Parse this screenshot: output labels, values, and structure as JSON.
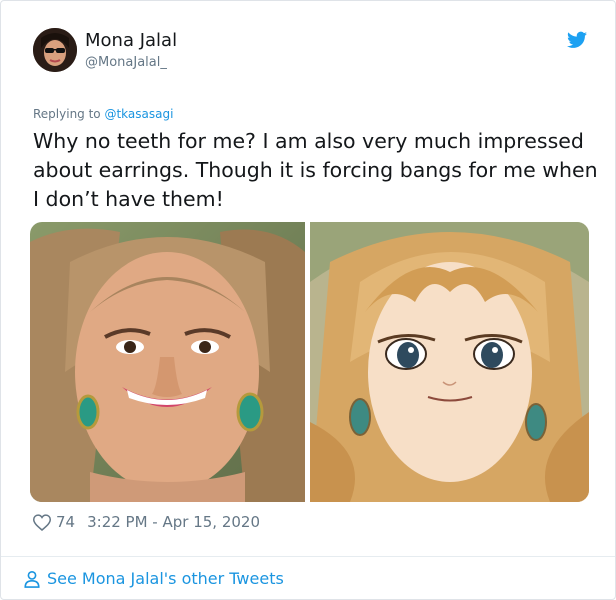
{
  "author": {
    "name": "Mona Jalal",
    "handle": "@MonaJalal_"
  },
  "reply": {
    "prefix": "Replying to ",
    "to": "@tkasasagi"
  },
  "tweet_text": "Why no teeth for me? I am also very much impressed about earrings. Though it is forcing bangs for me when I don’t have them!",
  "stats": {
    "likes": "74",
    "timestamp": "3:22 PM - Apr 15, 2020"
  },
  "footer": {
    "more_link": "See Mona Jalal's other Tweets"
  },
  "colors": {
    "link": "#1b95e0",
    "muted": "#657786",
    "text": "#14171a"
  },
  "icons": {
    "logo": "twitter-bird-icon",
    "like": "heart-outline-icon",
    "profile": "person-icon"
  }
}
